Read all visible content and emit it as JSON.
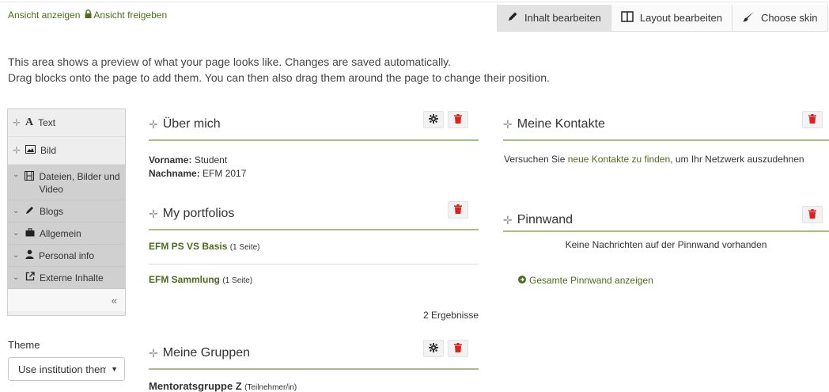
{
  "header": {
    "view_link": "Ansicht anzeigen",
    "share_link": "Ansicht freigeben",
    "tabs": [
      {
        "label": "Inhalt bearbeiten",
        "icon": "pencil-icon",
        "active": true
      },
      {
        "label": "Layout bearbeiten",
        "icon": "layout-icon",
        "active": false
      },
      {
        "label": "Choose skin",
        "icon": "brush-icon",
        "active": false
      }
    ]
  },
  "intro": {
    "line1": "This area shows a preview of what your page looks like. Changes are saved automatically.",
    "line2": "Drag blocks onto the page to add them. You can then also drag them around the page to change their position."
  },
  "palette": {
    "items": [
      {
        "label": "Text",
        "icon": "text-icon",
        "type": "plain"
      },
      {
        "label": "Bild",
        "icon": "image-icon",
        "type": "plain"
      },
      {
        "label": "Dateien, Bilder und Video",
        "icon": "film-icon",
        "type": "category"
      },
      {
        "label": "Blogs",
        "icon": "pencil-icon",
        "type": "category"
      },
      {
        "label": "Allgemein",
        "icon": "briefcase-icon",
        "type": "category"
      },
      {
        "label": "Personal info",
        "icon": "user-icon",
        "type": "category"
      },
      {
        "label": "Externe Inhalte",
        "icon": "external-link-icon",
        "type": "category"
      }
    ],
    "collapse_label": "«"
  },
  "theme": {
    "label": "Theme",
    "value": "Use institution theme"
  },
  "blocks": {
    "about": {
      "title": "Über mich",
      "first_name_label": "Vorname:",
      "first_name_value": "Student",
      "last_name_label": "Nachname:",
      "last_name_value": "EFM 2017"
    },
    "portfolios": {
      "title": "My portfolios",
      "items": [
        {
          "name": "EFM PS VS Basis",
          "count": "(1 Seite)"
        },
        {
          "name": "EFM Sammlung",
          "count": "(1 Seite)"
        }
      ],
      "results": "2 Ergebnisse"
    },
    "groups": {
      "title": "Meine Gruppen",
      "items": [
        {
          "name": "Mentoratsgruppe Z",
          "role": "(Teilnehmer/in)"
        }
      ]
    },
    "contacts": {
      "title": "Meine Kontakte",
      "text_before": "Versuchen Sie ",
      "link": "neue Kontakte zu finden",
      "text_after": ", um Ihr Netzwerk auszudehnen"
    },
    "wall": {
      "title": "Pinnwand",
      "empty_text": "Keine Nachrichten auf der Pinnwand vorhanden",
      "show_all": "Gesamte Pinnwand anzeigen"
    }
  },
  "colors": {
    "accent_green": "#4c6e1a",
    "divider_green": "#a9bd84",
    "delete_red": "#d9231c"
  }
}
